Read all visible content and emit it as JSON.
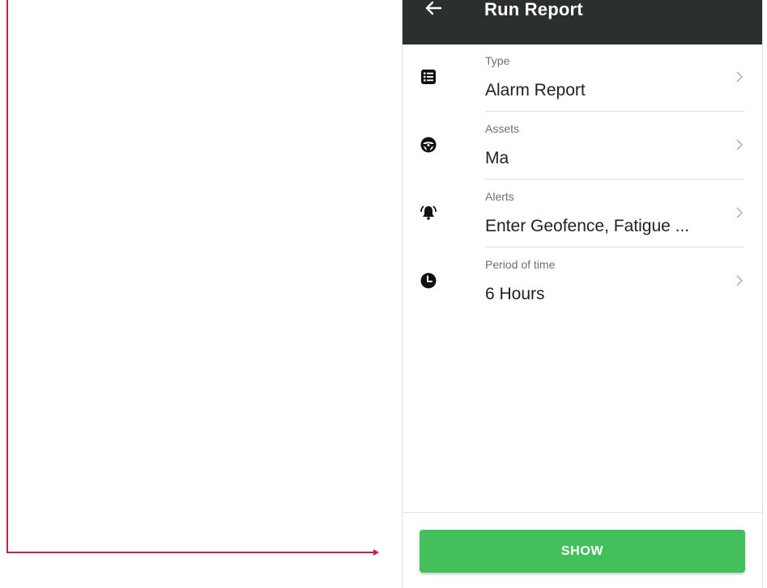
{
  "appbar": {
    "title": "Run Report",
    "back_icon": "arrow-left-icon"
  },
  "report_fields": [
    {
      "label": "Type",
      "value": "Alarm Report",
      "icon": "list-icon"
    },
    {
      "label": "Assets",
      "value": "Ma",
      "icon": "steering-wheel-icon"
    },
    {
      "label": "Alerts",
      "value": "Enter Geofence, Fatigue ...",
      "icon": "alarm-bell-icon"
    },
    {
      "label": "Period of time",
      "value": "6 Hours",
      "icon": "clock-icon"
    }
  ],
  "footer": {
    "show_label": "SHOW"
  },
  "colors": {
    "appbar_bg": "#2b2f2f",
    "button_green": "#43bf5c",
    "annotation_red": "#c8203f"
  }
}
